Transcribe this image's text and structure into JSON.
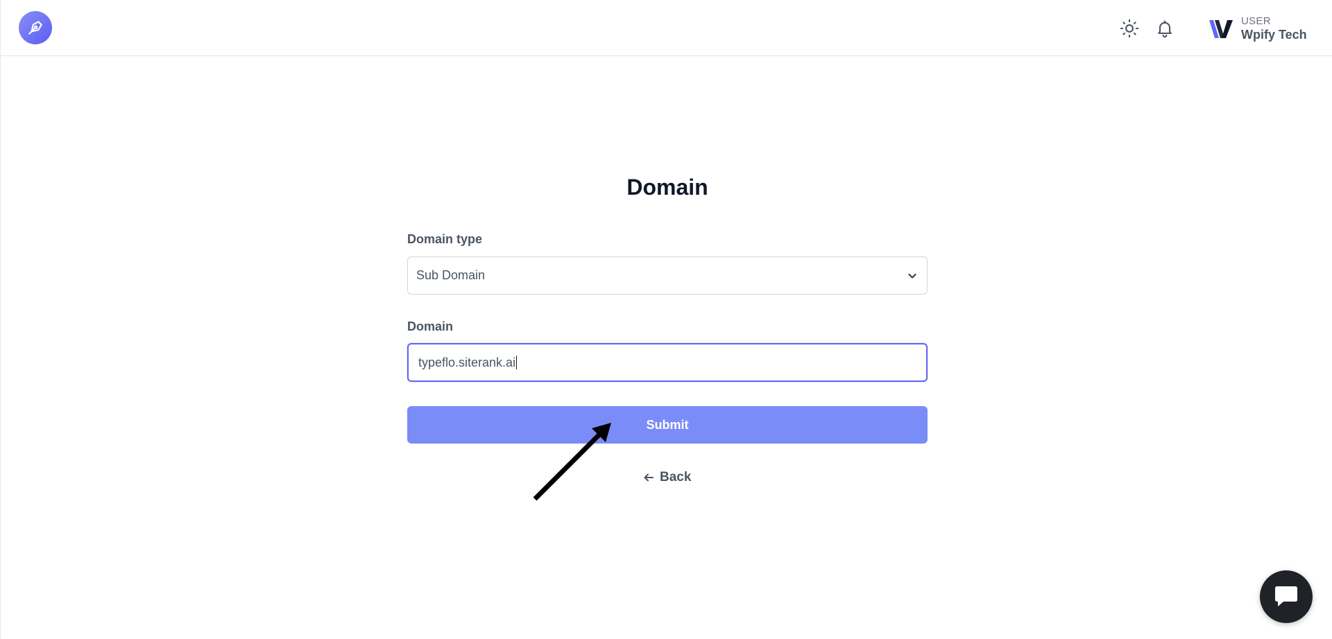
{
  "header": {
    "logo_icon": "pen-nib-icon",
    "theme_icon": "sun-icon",
    "notification_icon": "bell-icon",
    "user": {
      "role": "USER",
      "name": "Wpify Tech"
    }
  },
  "form": {
    "title": "Domain",
    "domain_type": {
      "label": "Domain type",
      "selected": "Sub Domain"
    },
    "domain": {
      "label": "Domain",
      "value": "typeflo.siterank.ai"
    },
    "submit_label": "Submit",
    "back_label": "Back"
  },
  "colors": {
    "accent": "#6366f1",
    "submit_bg": "#7a8cf7",
    "logo_gradient_start": "#8b8df7",
    "logo_gradient_end": "#5a5ef0",
    "chat_bg": "#1f2328"
  },
  "chat_icon": "chat-bubble-icon"
}
